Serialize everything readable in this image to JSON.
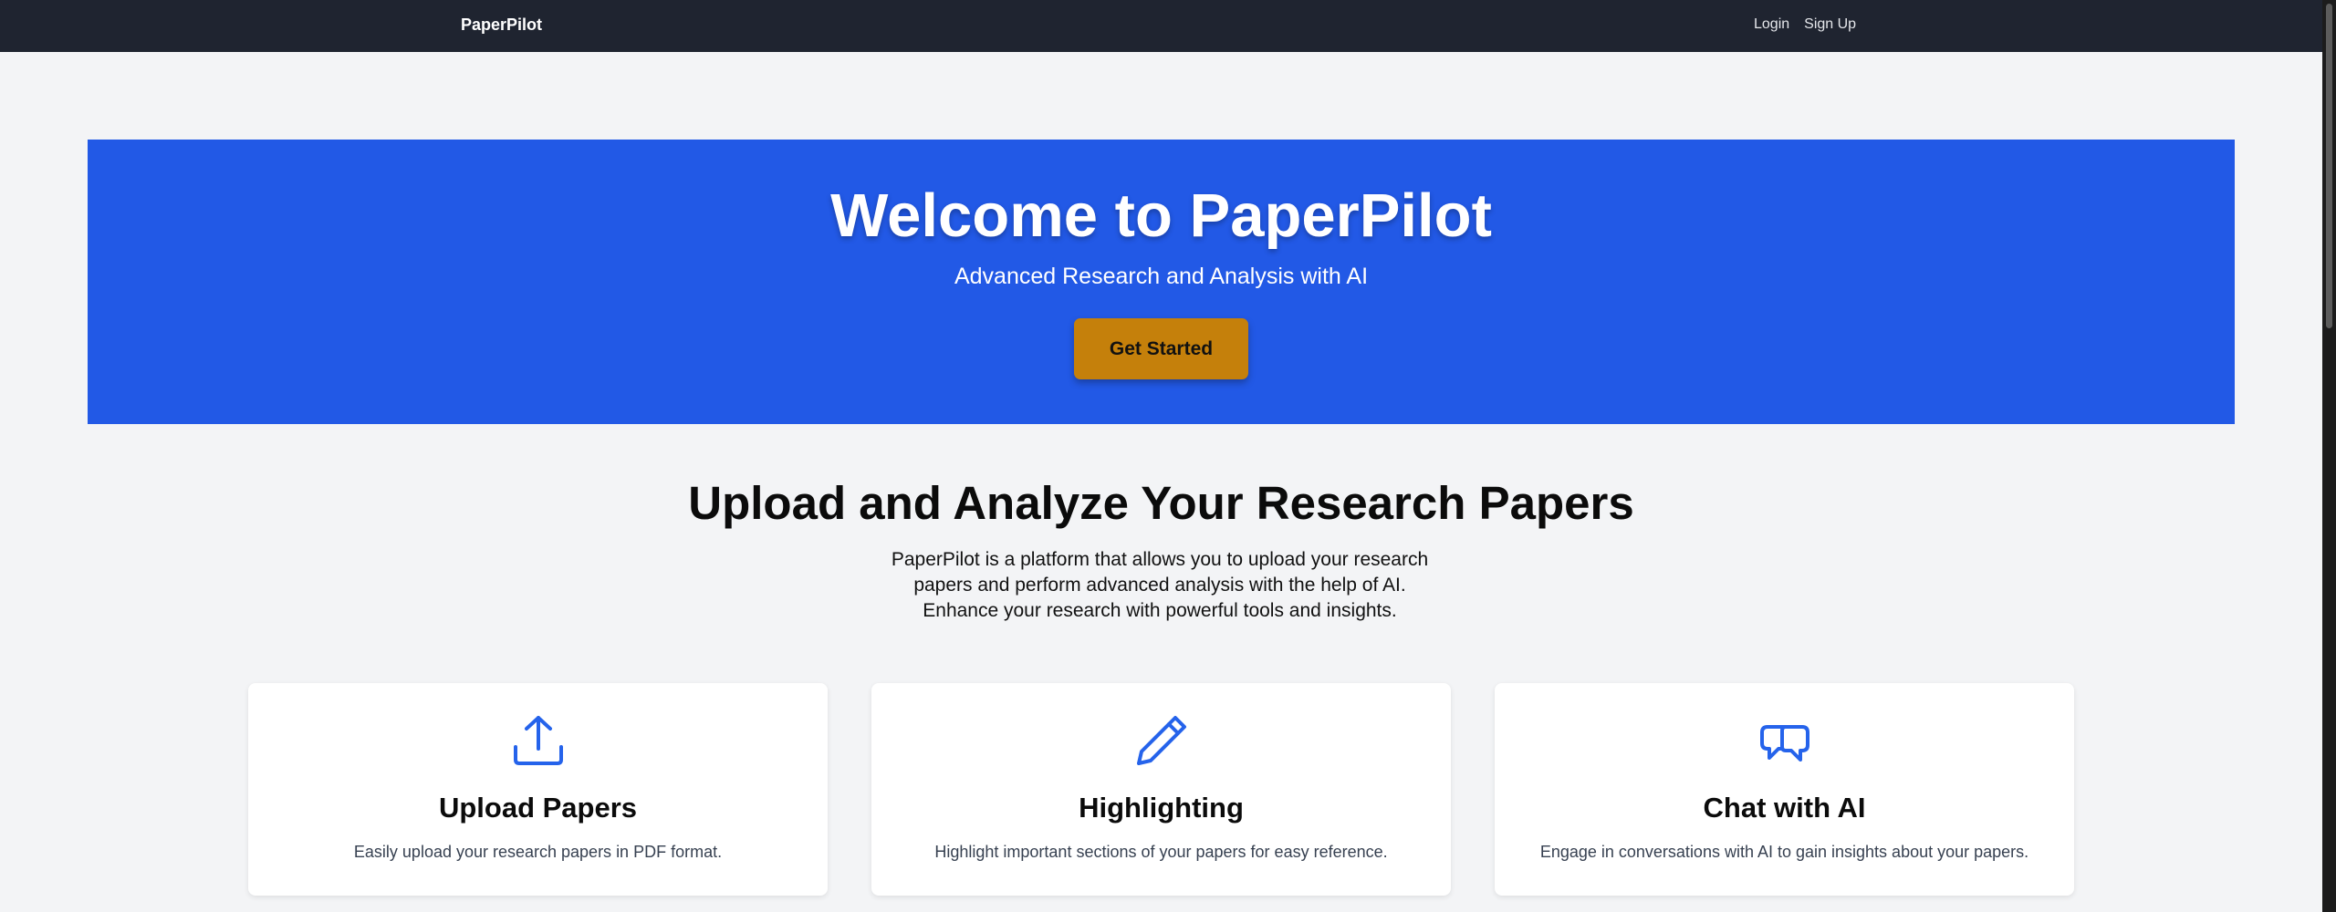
{
  "nav": {
    "brand": "PaperPilot",
    "links": [
      "Login",
      "Sign Up"
    ]
  },
  "hero": {
    "title": "Welcome to PaperPilot",
    "subtitle": "Advanced Research and Analysis with AI",
    "cta_label": "Get Started"
  },
  "intro": {
    "title": "Upload and Analyze Your Research Papers",
    "description_lines": [
      "PaperPilot is a platform that allows you to upload your research",
      "papers and perform advanced analysis with the help of AI.",
      "Enhance your research with powerful tools and insights."
    ]
  },
  "features": [
    {
      "icon": "upload-icon",
      "title": "Upload Papers",
      "description": "Easily upload your research papers in PDF format."
    },
    {
      "icon": "pencil-icon",
      "title": "Highlighting",
      "description": "Highlight important sections of your papers for easy reference."
    },
    {
      "icon": "chat-bubbles-icon",
      "title": "Chat with AI",
      "description": "Engage in conversations with AI to gain insights about your papers."
    }
  ],
  "colors": {
    "navbar": "#1f2430",
    "hero": "#2259e6",
    "cta": "#c5800b",
    "icon": "#2563eb",
    "page_bg": "#f3f4f6"
  }
}
